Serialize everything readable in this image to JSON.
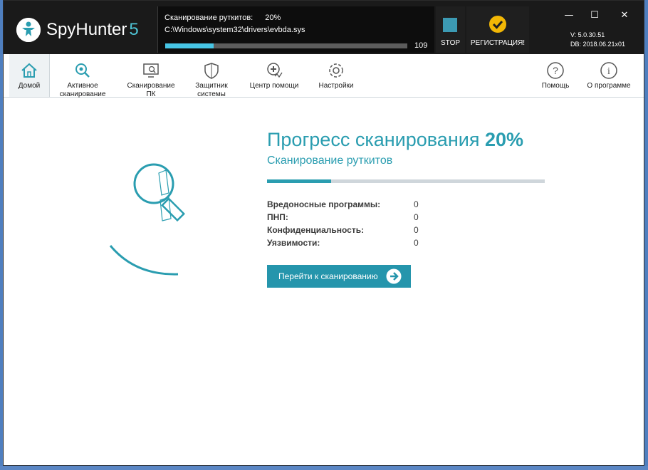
{
  "app": {
    "name": "SpyHunter",
    "version_digit": "5"
  },
  "scan": {
    "label": "Сканирование руткитов:",
    "percent": "20%",
    "path": "C:\\Windows\\system32\\drivers\\evbda.sys",
    "progress_fraction": 0.2,
    "count": "109"
  },
  "stop": {
    "label": "STOP"
  },
  "register": {
    "label": "РЕГИСТРАЦИЯ!"
  },
  "window_controls": {
    "minimize": "—",
    "maximize": "☐",
    "close": "✕"
  },
  "version": {
    "v": "V: 5.0.30.51",
    "db": "DB: 2018.06.21x01"
  },
  "toolbar": {
    "home": "Домой",
    "active_scan_1": "Активное",
    "active_scan_2": "сканирование",
    "pc_scan_1": "Сканирование",
    "pc_scan_2": "ПК",
    "guard_1": "Защитник",
    "guard_2": "системы",
    "help_center": "Центр помощи",
    "settings": "Настройки",
    "help": "Помощь",
    "about": "О программе"
  },
  "main": {
    "title_prefix": "Прогресс сканирования",
    "title_percent": "20%",
    "subtitle": "Сканирование руткитов",
    "progress_fraction": 0.23,
    "stats": [
      {
        "label": "Вредоносные программы:",
        "value": "0"
      },
      {
        "label": "ПНП:",
        "value": "0"
      },
      {
        "label": "Конфиденциальность:",
        "value": "0"
      },
      {
        "label": "Уязвимости:",
        "value": "0"
      }
    ],
    "go_button": "Перейти к сканированию"
  },
  "colors": {
    "accent": "#2a9db0",
    "header_bg": "#1a1a1a",
    "scan_bar": "#47c6e6",
    "stop": "#3c9ab3",
    "check": "#f2b705"
  }
}
